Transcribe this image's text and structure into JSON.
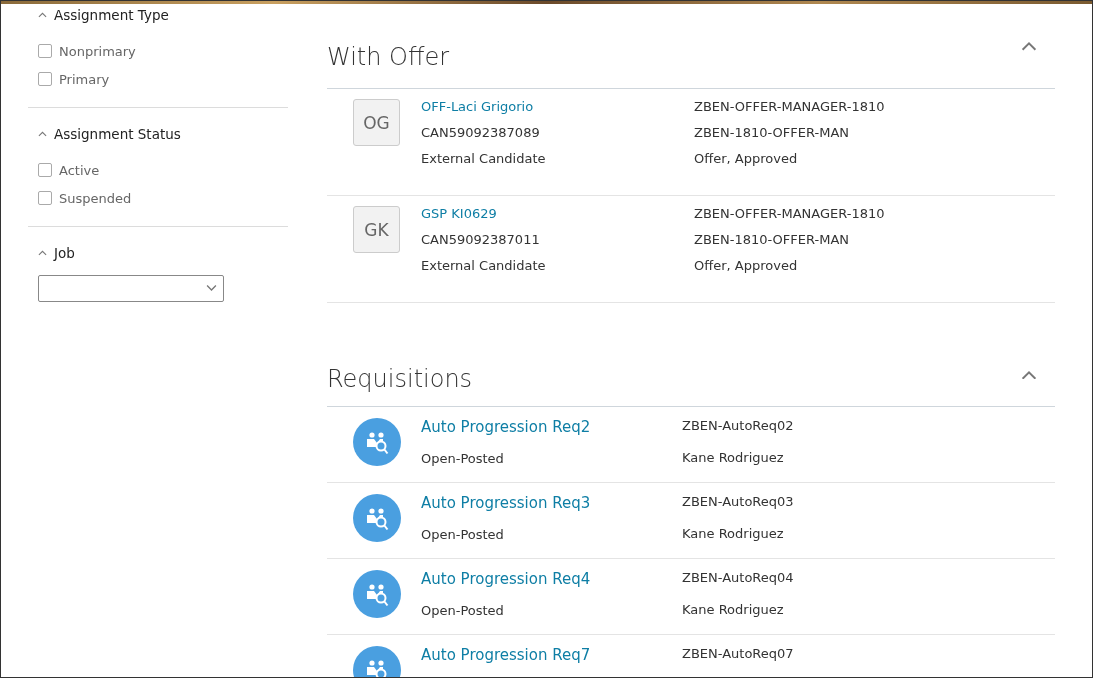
{
  "filters": [
    {
      "title": "Assignment Type",
      "expanded": true,
      "kind": "checkboxes",
      "options": [
        {
          "label": "Nonprimary",
          "checked": false
        },
        {
          "label": "Primary",
          "checked": false
        }
      ]
    },
    {
      "title": "Assignment Status",
      "expanded": true,
      "kind": "checkboxes",
      "options": [
        {
          "label": "Active",
          "checked": false
        },
        {
          "label": "Suspended",
          "checked": false
        }
      ]
    },
    {
      "title": "Job",
      "expanded": true,
      "kind": "dropdown"
    }
  ],
  "with_offer": {
    "title": "With Offer",
    "expanded": true,
    "rows": [
      {
        "initials": "OG",
        "name": "OFF-Laci Grigorio",
        "candidate_number": "CAN59092387089",
        "candidate_type": "External Candidate",
        "requisition": "ZBEN-OFFER-MANAGER-1810",
        "requisition_code": "ZBEN-1810-OFFER-MAN",
        "status": "Offer, Approved"
      },
      {
        "initials": "GK",
        "name": "GSP KI0629",
        "candidate_number": "CAN59092387011",
        "candidate_type": "External Candidate",
        "requisition": "ZBEN-OFFER-MANAGER-1810",
        "requisition_code": "ZBEN-1810-OFFER-MAN",
        "status": "Offer, Approved"
      }
    ]
  },
  "requisitions": {
    "title": "Requisitions",
    "expanded": true,
    "rows": [
      {
        "title": "Auto Progression Req2",
        "code": "ZBEN-AutoReq02",
        "status": "Open-Posted",
        "recruiter": "Kane Rodriguez"
      },
      {
        "title": "Auto Progression Req3",
        "code": "ZBEN-AutoReq03",
        "status": "Open-Posted",
        "recruiter": "Kane Rodriguez"
      },
      {
        "title": "Auto Progression Req4",
        "code": "ZBEN-AutoReq04",
        "status": "Open-Posted",
        "recruiter": "Kane Rodriguez"
      },
      {
        "title": "Auto Progression Req7",
        "code": "ZBEN-AutoReq07"
      }
    ]
  }
}
